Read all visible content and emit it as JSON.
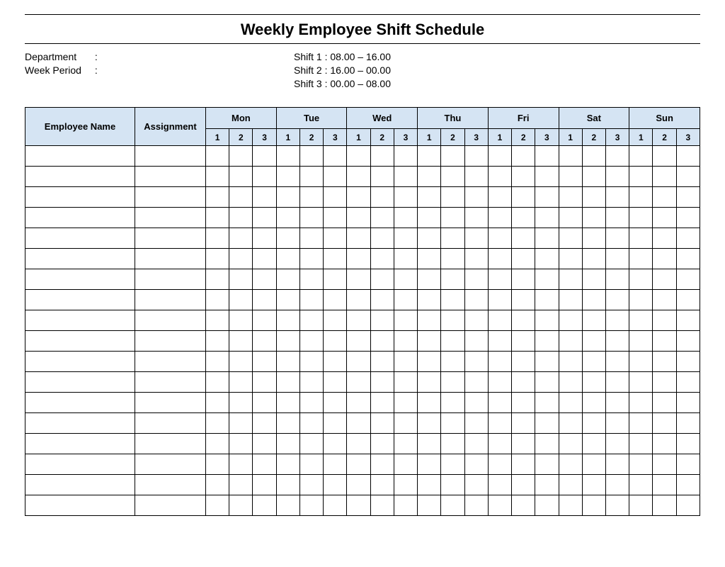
{
  "title": "Weekly Employee Shift Schedule",
  "meta": {
    "department_label": "Department",
    "department_value": "",
    "week_period_label": "Week Period",
    "week_period_value": ""
  },
  "shifts": {
    "line1": "Shift 1 : 08.00 – 16.00",
    "line2": "Shift 2 : 16.00 – 00.00",
    "line3": "Shift 3 : 00.00 – 08.00"
  },
  "headers": {
    "employee_name": "Employee Name",
    "assignment": "Assignment",
    "days": [
      "Mon",
      "Tue",
      "Wed",
      "Thu",
      "Fri",
      "Sat",
      "Sun"
    ],
    "sub": [
      "1",
      "2",
      "3"
    ]
  },
  "row_count": 18
}
